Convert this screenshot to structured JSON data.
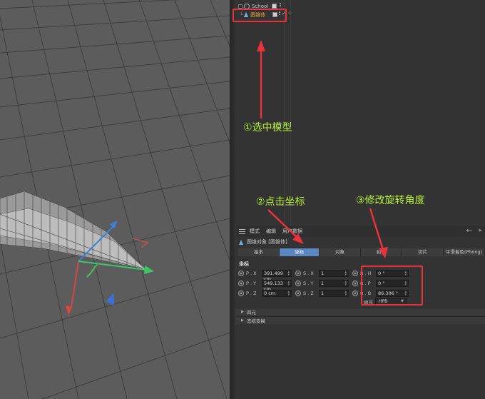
{
  "object_manager": {
    "parent_object": "School",
    "selected_object": "圆锥体"
  },
  "annotations": {
    "step1": "①选中模型",
    "step2": "②点击坐标",
    "step3": "③修改旋转角度"
  },
  "attribute_manager": {
    "menu": [
      "模式",
      "编辑",
      "用户数据"
    ],
    "nav_back": "←",
    "object_label": "圆锥对象 [圆锥体]",
    "tabs": [
      "基本",
      "坐标",
      "对象",
      "封顶",
      "切片",
      "平滑着色(Phong)"
    ],
    "active_tab": "坐标",
    "section_title": "坐标",
    "position": [
      {
        "label": "P . X",
        "value": "391.499 cm"
      },
      {
        "label": "P . Y",
        "value": "549.133 cm"
      },
      {
        "label": "P . Z",
        "value": "0 cm"
      }
    ],
    "scale": [
      {
        "label": "S . X",
        "value": "1"
      },
      {
        "label": "S . Y",
        "value": "1"
      },
      {
        "label": "S . Z",
        "value": "1"
      }
    ],
    "rotation": [
      {
        "label": "R . H",
        "value": "0 °"
      },
      {
        "label": "R . P",
        "value": "0 °"
      },
      {
        "label": "R . B",
        "value": "86.306 °"
      }
    ],
    "order_label": "顺序",
    "order_value": "HPB",
    "collapsible": [
      "四元",
      "冻结变换"
    ]
  },
  "colors": {
    "annotation_green": "#b6f235",
    "highlight_red": "#e8323c",
    "active_tab_blue": "#5b86c1",
    "axis_x": "#d9453f",
    "axis_y": "#3fc46a",
    "axis_z": "#3c7fd6"
  }
}
